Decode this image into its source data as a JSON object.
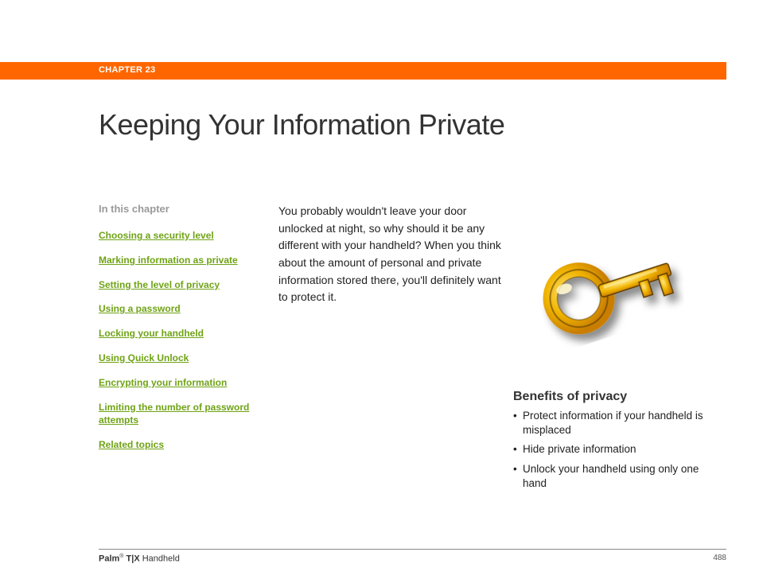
{
  "chapter_label": "CHAPTER 23",
  "title": "Keeping Your Information Private",
  "sidebar": {
    "heading": "In this chapter",
    "links": [
      "Choosing a security level",
      "Marking information as private",
      "Setting the level of privacy",
      "Using a password",
      "Locking your handheld",
      "Using Quick Unlock",
      "Encrypting your information",
      "Limiting the number of password attempts",
      "Related topics"
    ]
  },
  "intro": "You probably wouldn't leave your door unlocked at night, so why should it be any different with your handheld? When you think about the amount of personal and private information stored there, you'll definitely want to protect it.",
  "benefits": {
    "heading": "Benefits of privacy",
    "items": [
      "Protect information if your handheld is misplaced",
      "Hide private information",
      "Unlock your handheld using only one hand"
    ]
  },
  "footer": {
    "brand": "Palm",
    "reg": "®",
    "product": " T|X",
    "suffix": " Handheld",
    "page": "488"
  }
}
